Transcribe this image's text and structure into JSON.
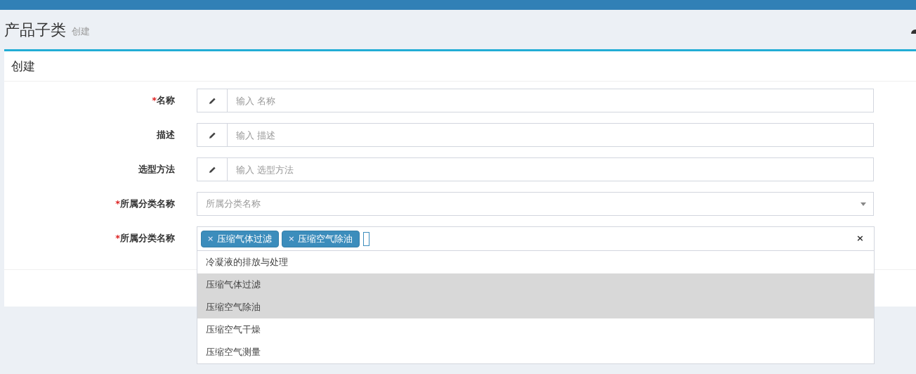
{
  "page_header": {
    "title": "产品子类",
    "subtitle": "创建"
  },
  "box": {
    "title": "创建"
  },
  "fields": [
    {
      "kind": "text",
      "required_mark": "*",
      "label": "名称",
      "placeholder": "输入 名称"
    },
    {
      "kind": "text",
      "label": "描述",
      "placeholder": "输入 描述"
    },
    {
      "kind": "text",
      "label": "选型方法",
      "placeholder": "输入 选型方法"
    },
    {
      "kind": "select",
      "required_mark": "*",
      "label": "所属分类名称",
      "placeholder": "所属分类名称"
    },
    {
      "kind": "multiselect",
      "required_mark": "*",
      "label": "所属分类名称",
      "clear": "×",
      "tags": [
        {
          "remove": "×",
          "label": "压缩气体过滤"
        },
        {
          "remove": "×",
          "label": "压缩空气除油"
        }
      ],
      "options": [
        {
          "label": "冷凝液的排放与处理",
          "selected": false
        },
        {
          "label": "压缩气体过滤",
          "selected": true
        },
        {
          "label": "压缩空气除油",
          "selected": true
        },
        {
          "label": "压缩空气干燥",
          "selected": false
        },
        {
          "label": "压缩空气测量",
          "selected": false
        }
      ]
    }
  ]
}
